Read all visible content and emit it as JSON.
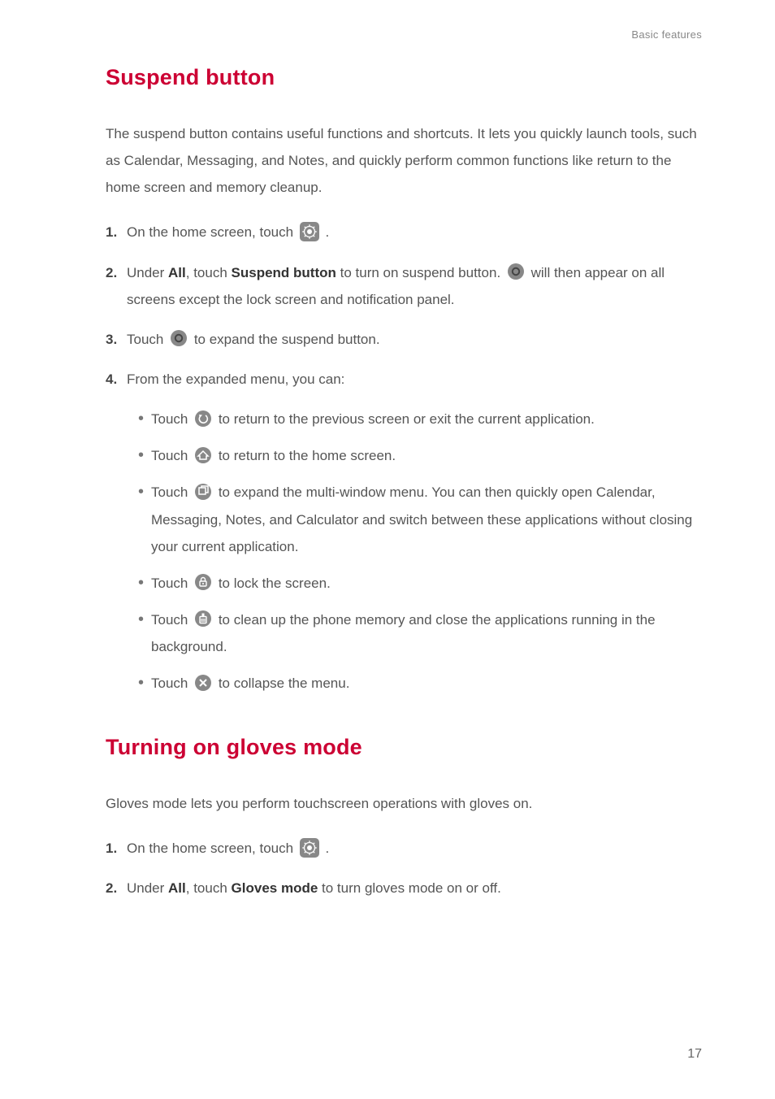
{
  "header": {
    "section": "Basic features"
  },
  "section1": {
    "title": "Suspend button",
    "intro": "The suspend button contains useful functions and shortcuts. It lets you quickly launch tools, such as Calendar, Messaging, and Notes, and quickly perform common functions like return to the home screen and memory cleanup.",
    "step1_prefix": "On the home screen, touch ",
    "step1_suffix": ".",
    "step2_prefix": "Under ",
    "step2_all": "All",
    "step2_touch": ", touch ",
    "step2_sb": "Suspend button",
    "step2_mid": " to turn on suspend button. ",
    "step2_suffix": " will then appear on all screens except the lock screen and notification panel.",
    "step3_prefix": "Touch ",
    "step3_suffix": " to expand the suspend button.",
    "step4": "From the expanded menu, you can:",
    "b1_prefix": "Touch ",
    "b1_suffix": " to return to the previous screen or exit the current application.",
    "b2_prefix": "Touch ",
    "b2_suffix": " to return to the home screen.",
    "b3_prefix": "Touch ",
    "b3_suffix": " to expand the multi-window menu. You can then quickly open Calendar, Messaging, Notes, and Calculator and switch between these applications without closing your current application.",
    "b4_prefix": "Touch ",
    "b4_suffix": " to lock the screen.",
    "b5_prefix": "Touch ",
    "b5_suffix": " to clean up the phone memory and close the applications running in the background.",
    "b6_prefix": "Touch ",
    "b6_suffix": " to collapse the menu."
  },
  "section2": {
    "title": "Turning on gloves mode",
    "intro": "Gloves mode lets you perform touchscreen operations with gloves on.",
    "step1_prefix": "On the home screen, touch ",
    "step1_suffix": ".",
    "step2_prefix": "Under ",
    "step2_all": "All",
    "step2_touch": ", touch ",
    "step2_gm": "Gloves mode",
    "step2_suffix": " to turn gloves mode on or off."
  },
  "page": "17"
}
